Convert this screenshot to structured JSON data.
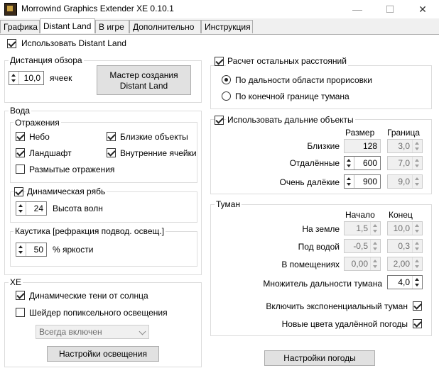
{
  "window": {
    "title": "Morrowind Graphics Extender XE 0.10.1",
    "minimize": "—",
    "maximize": "☐",
    "close": "✕"
  },
  "tabs": [
    "Графика",
    "Distant Land",
    "В игре",
    "Дополнительно",
    "Инструкция"
  ],
  "use_distant_land": "Использовать Distant Land",
  "view_distance": {
    "title": "Дистанция обзора",
    "value": "10,0",
    "unit": "ячеек",
    "wizard": "Мастер создания Distant Land"
  },
  "water": {
    "title": "Вода",
    "reflections": {
      "title": "Отражения",
      "sky": "Небо",
      "landscape": "Ландшафт",
      "near_objects": "Близкие объекты",
      "interior": "Внутренние ячейки",
      "blurred": "Размытые отражения"
    },
    "ripples": {
      "title": "Динамическая рябь",
      "value": "24",
      "label": "Высота волн"
    },
    "caustics": {
      "title": "Каустика [рефракция подвод. освещ.]",
      "value": "50",
      "label": "% яркости"
    }
  },
  "xe": {
    "title": "XE",
    "sun_shadows": "Динамические тени от солнца",
    "pixel_shader": "Шейдер попиксельного освещения",
    "mode": "Всегда включен",
    "lighting_btn": "Настройки освещения"
  },
  "distances": {
    "title": "Расчет остальных расстояний",
    "by_draw": "По дальности области прорисовки",
    "by_fog": "По конечной границе тумана"
  },
  "far_objects": {
    "title": "Использовать дальние объекты",
    "col_size": "Размер",
    "col_limit": "Граница",
    "rows": [
      {
        "label": "Близкие",
        "size": "128",
        "limit": "3,0"
      },
      {
        "label": "Отдалённые",
        "size": "600",
        "limit": "7,0"
      },
      {
        "label": "Очень далёкие",
        "size": "900",
        "limit": "9,0"
      }
    ]
  },
  "fog": {
    "title": "Туман",
    "col_start": "Начало",
    "col_end": "Конец",
    "rows": [
      {
        "label": "На земле",
        "start": "1,5",
        "end": "10,0"
      },
      {
        "label": "Под водой",
        "start": "-0,5",
        "end": "0,3"
      },
      {
        "label": "В помещениях",
        "start": "0,00",
        "end": "2,00"
      }
    ],
    "multiplier_label": "Множитель дальности тумана",
    "multiplier": "4,0",
    "exp_fog": "Включить экспоненциальный туман",
    "weather_colors": "Новые цвета удалённой погоды",
    "weather_btn": "Настройки погоды"
  }
}
